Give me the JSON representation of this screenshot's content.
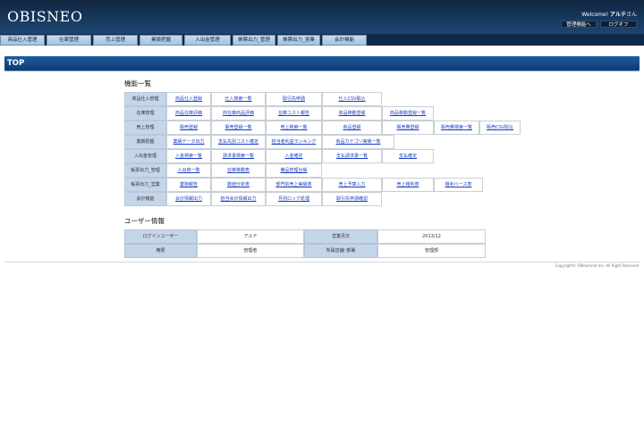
{
  "header": {
    "logo": "OBISNEO",
    "welcome_prefix": "Welcome!",
    "user_name": "アルテ",
    "honorific": "さん",
    "admin_button": "管理機能へ",
    "logout_button": "ログオフ"
  },
  "nav": [
    "商品仕入管理",
    "在庫管理",
    "売上管理",
    "業績把握",
    "入出金管理",
    "帳票出力_管理",
    "帳票出力_営業",
    "会計機能"
  ],
  "section_title": "TOP",
  "functions": {
    "title": "機能一覧",
    "rows": [
      {
        "label": "商品仕入管理",
        "items": [
          "商品仕入登録",
          "仕入検索一覧",
          "取引先申請",
          "仕入CSV取込"
        ]
      },
      {
        "label": "在庫管理",
        "items": [
          "商品在庫評価",
          "商在庫商品評価",
          "在庫コスト報告",
          "商品移動登録",
          "商品移動登録一覧"
        ]
      },
      {
        "label": "売上管理",
        "items": [
          "販売登録",
          "販売登録一覧",
          "売上検索一覧",
          "商品登録",
          "販売費登録",
          "販売費検索一覧",
          "販売CSV取込"
        ]
      },
      {
        "label": "業績把握",
        "items": [
          "業績データ出力",
          "支払先別コスト確定",
          "担当者利益ランキング",
          "商品カテゴリ実績一覧"
        ]
      },
      {
        "label": "入出金管理",
        "items": [
          "入金検索一覧",
          "請求書検索一覧",
          "入金確定",
          "支払請求書一覧",
          "支払確定"
        ]
      },
      {
        "label": "帳票出力_管理",
        "items": [
          "入出荷一覧",
          "在庫移動表",
          "備品管理台帳"
        ]
      },
      {
        "label": "帳票出力_営業",
        "items": [
          "業務報告",
          "数値分析表",
          "部門別売上実績表",
          "売上予算入力",
          "売上粗利表",
          "粗利ベース表"
        ]
      },
      {
        "label": "会計機能",
        "items": [
          "会計情報出力",
          "担当会計情報出力",
          "月別ロック処理",
          "取引先申請確認"
        ]
      }
    ]
  },
  "user_info": {
    "title": "ユーザー情報",
    "login_user_label": "ログインユーザー",
    "login_user_value": "アルテ",
    "business_month_label": "営業月次",
    "business_month_value": "2013/12",
    "authority_label": "権限",
    "authority_value": "管理者",
    "store_label": "所属店舗･部署",
    "store_value": "管理部"
  },
  "footer": {
    "copyright": "Copyright© OBIcomnet Inc. All Right Reserved"
  }
}
